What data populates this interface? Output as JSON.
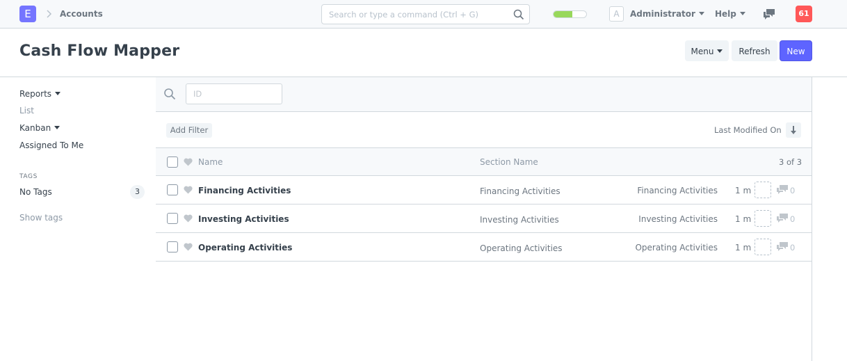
{
  "navbar": {
    "logo_letter": "E",
    "breadcrumb": "Accounts",
    "search_placeholder": "Search or type a command (Ctrl + G)",
    "setup_progress": 0.58,
    "avatar_letter": "A",
    "user": "Administrator",
    "help": "Help",
    "notification_count": "61"
  },
  "page": {
    "title": "Cash Flow Mapper",
    "menu_label": "Menu",
    "refresh_label": "Refresh",
    "new_label": "New"
  },
  "sidebar": {
    "reports": "Reports",
    "list": "List",
    "kanban": "Kanban",
    "assigned_to_me": "Assigned To Me",
    "tags_heading": "TAGS",
    "no_tags": "No Tags",
    "no_tags_count": "3",
    "show_tags": "Show tags"
  },
  "filters": {
    "id_placeholder": "ID",
    "add_filter": "Add Filter",
    "sort_by": "Last Modified On"
  },
  "list": {
    "columns": {
      "name": "Name",
      "section_name": "Section Name"
    },
    "count": "3 of 3",
    "rows": [
      {
        "name": "Financing Activities",
        "section_name": "Financing Activities",
        "tag": "Financing Activities",
        "modified": "1 m",
        "comments": "0"
      },
      {
        "name": "Investing Activities",
        "section_name": "Investing Activities",
        "tag": "Investing Activities",
        "modified": "1 m",
        "comments": "0"
      },
      {
        "name": "Operating Activities",
        "section_name": "Operating Activities",
        "tag": "Operating Activities",
        "modified": "1 m",
        "comments": "0"
      }
    ]
  },
  "colors": {
    "primary": "#5e64ff",
    "logo": "#7575ff",
    "notification": "#ff5858",
    "progress": "#98d85b",
    "border": "#d1d8dd"
  }
}
